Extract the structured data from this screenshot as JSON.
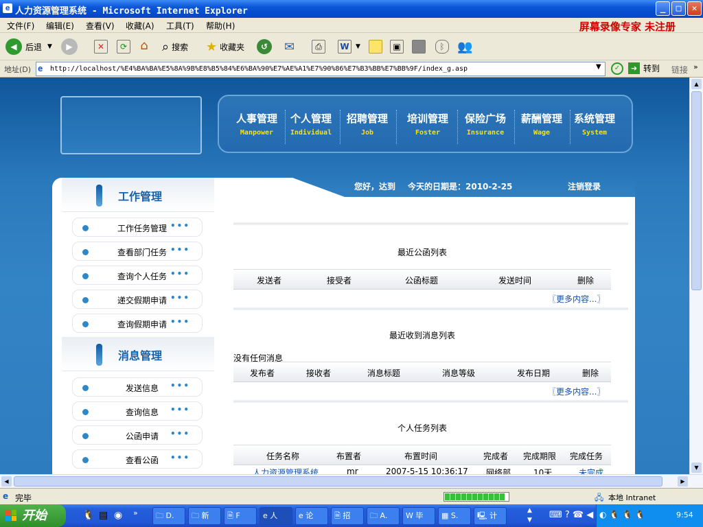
{
  "window": {
    "title": "人力资源管理系统 - Microsoft Internet Explorer",
    "minimize": "_",
    "maximize": "□",
    "close": "✕"
  },
  "menu": {
    "items": [
      "文件(F)",
      "编辑(E)",
      "查看(V)",
      "收藏(A)",
      "工具(T)",
      "帮助(H)"
    ],
    "promo": "屏幕录像专家 未注册"
  },
  "toolbar": {
    "back": "后退",
    "search": "搜索",
    "favorites": "收藏夹"
  },
  "address": {
    "label": "地址(D)",
    "url": "http://localhost/%E4%BA%BA%E5%8A%9B%E8%B5%84%E6%BA%90%E7%AE%A1%E7%90%86%E7%B3%BB%E7%BB%9F/index_g.asp",
    "go": "转到",
    "links": "链接"
  },
  "nav": [
    {
      "cn": "人事管理",
      "en": "Manpower"
    },
    {
      "cn": "个人管理",
      "en": "Individual"
    },
    {
      "cn": "招聘管理",
      "en": "Job"
    },
    {
      "cn": "培训管理",
      "en": "Foster"
    },
    {
      "cn": "保险广场",
      "en": "Insurance"
    },
    {
      "cn": "薪酬管理",
      "en": "Wage"
    },
    {
      "cn": "系统管理",
      "en": "System"
    }
  ],
  "greeting": {
    "hello": "您好，达到",
    "date": "今天的日期是：2010-2-25",
    "logout": "注销登录"
  },
  "sidebar": {
    "work": {
      "title": "工作管理",
      "items": [
        "工作任务管理",
        "查看部门任务",
        "查询个人任务",
        "递交假期申请",
        "查询假期申请"
      ]
    },
    "msg": {
      "title": "消息管理",
      "items": [
        "发送信息",
        "查询信息",
        "公函申请",
        "查看公函"
      ]
    },
    "more_dots": "•••"
  },
  "letters": {
    "title": "最近公函列表",
    "headers": [
      "发送者",
      "接受者",
      "公函标题",
      "发送时间",
      "删除"
    ],
    "more": "〖更多内容...〗"
  },
  "messages": {
    "title": "最近收到消息列表",
    "empty": "没有任何消息",
    "headers": [
      "发布者",
      "接收者",
      "消息标题",
      "消息等级",
      "发布日期",
      "删除"
    ],
    "more": "〖更多内容...〗"
  },
  "tasks": {
    "title": "个人任务列表",
    "headers": [
      "任务名称",
      "布置者",
      "布置时间",
      "完成者",
      "完成期限",
      "完成任务"
    ],
    "row": [
      "人力资源管理系统",
      "mr",
      "2007-5-15 10:36:17",
      "网络部",
      "10天",
      "未完成"
    ]
  },
  "status": {
    "text": "完毕",
    "zone": "本地 Intranet"
  },
  "taskbar": {
    "start": "开始",
    "buttons": [
      "D.",
      "新",
      "F",
      "人",
      "论",
      "招",
      "A.",
      "毕",
      "S.",
      "计"
    ],
    "clock": "9:54"
  },
  "colors": {
    "accent": "#1462ae",
    "nav_en": "#ffe400",
    "link": "#1250b0",
    "promo": "#d40000"
  }
}
